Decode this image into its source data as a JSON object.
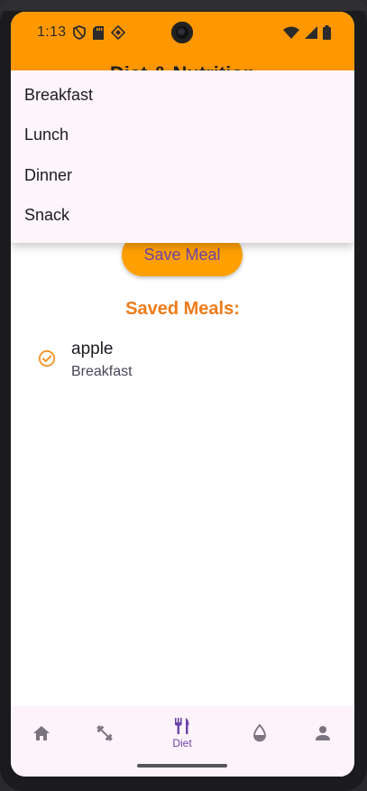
{
  "status_bar": {
    "time": "1:13"
  },
  "app_bar": {
    "title": "Diet & Nutrition",
    "background_color": "#ff9800"
  },
  "meal_type_menu": {
    "items": [
      {
        "label": "Breakfast"
      },
      {
        "label": "Lunch"
      },
      {
        "label": "Dinner"
      },
      {
        "label": "Snack"
      }
    ]
  },
  "actions": {
    "save_label": "Save Meal"
  },
  "saved_meals": {
    "heading": "Saved Meals:",
    "items": [
      {
        "name": "apple",
        "meal_type": "Breakfast",
        "icon": "check-circle-icon"
      }
    ]
  },
  "bottom_nav": {
    "items": [
      {
        "icon": "home-icon",
        "label": ""
      },
      {
        "icon": "dumbbell-icon",
        "label": ""
      },
      {
        "icon": "restaurant-icon",
        "label": "Diet",
        "selected": true
      },
      {
        "icon": "water-drop-icon",
        "label": ""
      },
      {
        "icon": "person-icon",
        "label": ""
      }
    ],
    "selected_color": "#6b45a8"
  }
}
